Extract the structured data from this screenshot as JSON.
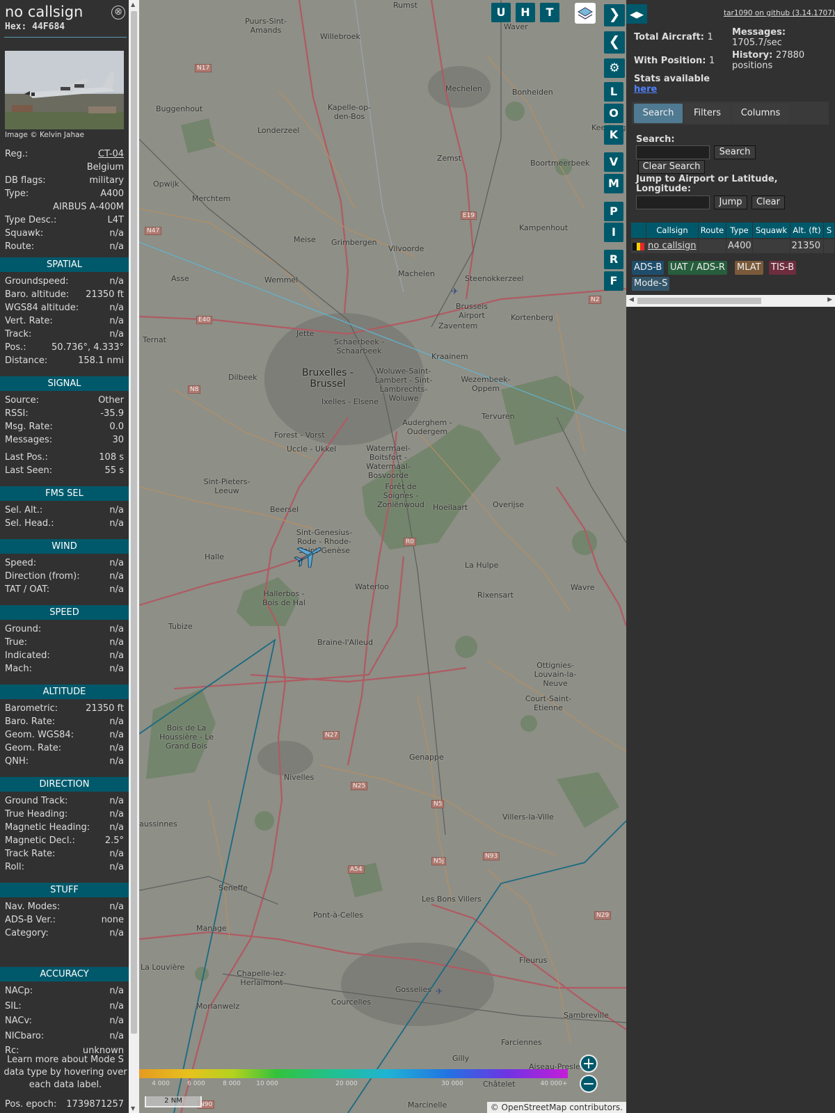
{
  "info": {
    "callsign": "no callsign",
    "hex": "Hex: 44F684",
    "close": "⊗",
    "photo_credit": "Image © Kelvin Jahae",
    "rows_top": [
      {
        "k": "Reg.:",
        "v": "CT-04",
        "link": true
      },
      {
        "k": "",
        "v": "Belgium"
      },
      {
        "k": "DB flags:",
        "v": "military"
      },
      {
        "k": "Type:",
        "v": "A400"
      },
      {
        "k": "",
        "v": "AIRBUS A-400M"
      },
      {
        "k": "Type Desc.:",
        "v": "L4T"
      },
      {
        "k": "Squawk:",
        "v": "n/a"
      },
      {
        "k": "Route:",
        "v": "n/a"
      }
    ],
    "sections": [
      {
        "title": "SPATIAL",
        "rows": [
          {
            "k": "Groundspeed:",
            "v": "n/a"
          },
          {
            "k": "Baro. altitude:",
            "v": "21350 ft"
          },
          {
            "k": "WGS84 altitude:",
            "v": "n/a"
          },
          {
            "k": "Vert. Rate:",
            "v": "n/a"
          },
          {
            "k": "Track:",
            "v": "n/a"
          },
          {
            "k": "Pos.:",
            "v": "50.736°, 4.333°"
          },
          {
            "k": "Distance:",
            "v": "158.1 nmi"
          }
        ]
      },
      {
        "title": "SIGNAL",
        "rows": [
          {
            "k": "Source:",
            "v": "Other"
          },
          {
            "k": "RSSI:",
            "v": "-35.9"
          },
          {
            "k": "Msg. Rate:",
            "v": "0.0"
          },
          {
            "k": "Messages:",
            "v": "30"
          },
          {
            "k": "Last Pos.:",
            "v": "108 s"
          },
          {
            "k": "Last Seen:",
            "v": "55 s"
          }
        ]
      },
      {
        "title": "FMS SEL",
        "rows": [
          {
            "k": "Sel. Alt.:",
            "v": "n/a"
          },
          {
            "k": "Sel. Head.:",
            "v": "n/a"
          }
        ]
      },
      {
        "title": "WIND",
        "rows": [
          {
            "k": "Speed:",
            "v": "n/a"
          },
          {
            "k": "Direction (from):",
            "v": "n/a"
          },
          {
            "k": "TAT / OAT:",
            "v": "n/a"
          }
        ]
      },
      {
        "title": "SPEED",
        "rows": [
          {
            "k": "Ground:",
            "v": "n/a"
          },
          {
            "k": "True:",
            "v": "n/a"
          },
          {
            "k": "Indicated:",
            "v": "n/a"
          },
          {
            "k": "Mach:",
            "v": "n/a"
          }
        ]
      },
      {
        "title": "ALTITUDE",
        "rows": [
          {
            "k": "Barometric:",
            "v": "21350 ft"
          },
          {
            "k": "Baro. Rate:",
            "v": "n/a"
          },
          {
            "k": "Geom. WGS84:",
            "v": "n/a"
          },
          {
            "k": "Geom. Rate:",
            "v": "n/a"
          },
          {
            "k": "QNH:",
            "v": "n/a"
          }
        ]
      },
      {
        "title": "DIRECTION",
        "rows": [
          {
            "k": "Ground Track:",
            "v": "n/a"
          },
          {
            "k": "True Heading:",
            "v": "n/a"
          },
          {
            "k": "Magnetic Heading:",
            "v": "n/a"
          },
          {
            "k": "Magnetic Decl.:",
            "v": "2.5°"
          },
          {
            "k": "Track Rate:",
            "v": "n/a"
          },
          {
            "k": "Roll:",
            "v": "n/a"
          }
        ]
      },
      {
        "title": "STUFF",
        "rows": [
          {
            "k": "Nav. Modes:",
            "v": "n/a"
          },
          {
            "k": "ADS-B Ver.:",
            "v": "none"
          },
          {
            "k": "Category:",
            "v": "n/a"
          }
        ]
      },
      {
        "title": "ACCURACY",
        "rows": [
          {
            "k": "NACp:",
            "v": "n/a"
          },
          {
            "k": "SIL:",
            "v": "n/a"
          },
          {
            "k": "NACv:",
            "v": "n/a"
          },
          {
            "k": "NICbaro:",
            "v": "n/a"
          },
          {
            "k": "Rc:",
            "v": "unknown"
          }
        ]
      }
    ],
    "note": "Learn more about Mode S data type by hovering over each data label.",
    "epoch": {
      "k": "Pos. epoch:",
      "v": "1739871257"
    }
  },
  "map": {
    "buttons": [
      "U",
      "H",
      "T"
    ],
    "side_buttons": [
      "L",
      "O",
      "K",
      "V",
      "M",
      "P",
      "I",
      "R",
      "F"
    ],
    "colorbar_ticks": [
      "4 000",
      "6 000",
      "8 000",
      "10 000",
      "20 000",
      "30 000",
      "40 000+"
    ],
    "scale": "2 NM",
    "attribution": "© OpenStreetMap contributors.",
    "places": [
      "Rumst",
      "Waver",
      "Puurs-Sint-Amands",
      "Willebroek",
      "Mechelen",
      "Bonheiden",
      "Buggenhout",
      "Kapelle-op-den-Bos",
      "Londerzeel",
      "Zemst",
      "Keerbergen",
      "Boortmeerbeek",
      "Opwijk",
      "Merchtem",
      "Kampenhout",
      "Meise",
      "Grimbergen",
      "Vilvoorde",
      "Asse",
      "Wemmel",
      "Machelen",
      "Steenokkerzeel",
      "Brussels Airport",
      "Zaventem",
      "Kortenberg",
      "Ternat",
      "Jette",
      "Schaerbeek - Schaarbeek",
      "Kraainem",
      "Dilbeek",
      "Bruxelles - Brussel",
      "Woluwe-Saint-Lambert - Sint-Lambrechts-Woluwe",
      "Wezembeek-Oppem",
      "Ixelles - Elsene",
      "Tervuren",
      "Auderghem - Oudergem",
      "Forest - Vorst",
      "Uccle - Ukkel",
      "Watermael-Boitsfort - Watermaal-Bosvoorde",
      "Sint-Pieters-Leeuw",
      "Forêt de Soignes - Zoniënwoud",
      "Hoeilaart",
      "Overijse",
      "Beersel",
      "Sint-Genesius-Rode - Rhode-Saint-Genèse",
      "Halle",
      "La Hulpe",
      "Waterloo",
      "Rixensart",
      "Wavre",
      "Hallerbos - Bois de Hal",
      "Tubize",
      "Braine-l'Alleud",
      "Ottignies-Louvain-la-Neuve",
      "Court-Saint-Etienne",
      "Bois de La Houssière - Le Grand Bois",
      "Genappe",
      "Nivelles",
      "aussinnes",
      "Villers-la-Ville",
      "Seneffe",
      "Les Bons Villers",
      "Pont-à-Celles",
      "Manage",
      "La Louvière",
      "Chapelle-lez-Herlaimont",
      "Fleurus",
      "Gosselies",
      "Morlanwelz",
      "Courcelles",
      "Sambreville",
      "Farciennes",
      "Gilly",
      "Aiseau-Presles",
      "Châtelet",
      "Marcinelle"
    ],
    "roads": [
      "N17",
      "N47",
      "E40",
      "N8",
      "E19",
      "N2",
      "R0",
      "N27",
      "N25",
      "N5",
      "N5j",
      "N93",
      "A54",
      "N29",
      "N90"
    ]
  },
  "right": {
    "github": "tar1090 on github (3.14.1707)",
    "total_label": "Total Aircraft:",
    "total": "1",
    "position_label": "With Position:",
    "position": "1",
    "messages_label": "Messages:",
    "messages": "1705.7/sec",
    "history_label": "History:",
    "history": "27880 positions",
    "stats_label": "Stats available",
    "stats_link": "here",
    "tabs": [
      "Search",
      "Filters",
      "Columns"
    ],
    "search_label": "Search:",
    "search_btn": "Search",
    "clear_search_btn": "Clear Search",
    "jump_label": "Jump to Airport or Latitude, Longitude:",
    "jump_btn": "Jump",
    "clear_btn": "Clear",
    "table_headers": [
      "Callsign",
      "Route",
      "Type",
      "Squawk",
      "Alt. (ft)",
      "S"
    ],
    "table_row": {
      "callsign": "no callsign",
      "route": "",
      "type": "A400",
      "squawk": "",
      "alt": "21350"
    },
    "badges": [
      {
        "label": "ADS-B",
        "color": "#1e4d6b"
      },
      {
        "label": "UAT / ADS-R",
        "color": "#275e3d"
      },
      {
        "label": "MLAT",
        "color": "#7a5a3a"
      },
      {
        "label": "TIS-B",
        "color": "#6e2d3d"
      },
      {
        "label": "Mode-S",
        "color": "#33566b"
      }
    ]
  }
}
